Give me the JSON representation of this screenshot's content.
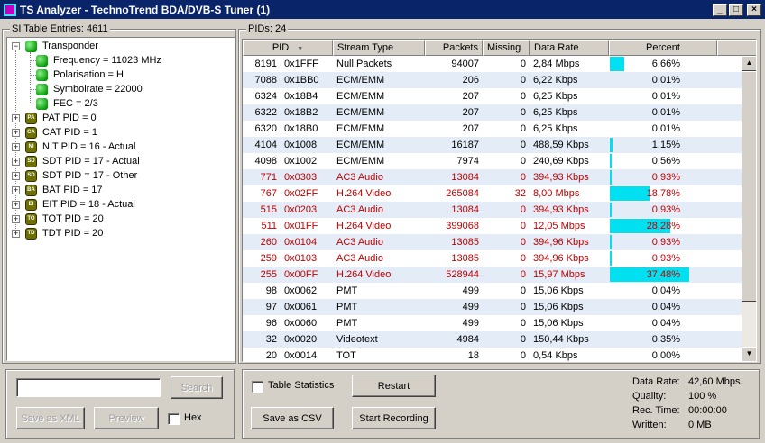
{
  "window": {
    "title": "TS Analyzer - TechnoTrend BDA/DVB-S Tuner (1)",
    "minimize": "_",
    "maximize": "□",
    "close": "×"
  },
  "si_panel": {
    "label": "SI Table Entries: 4611",
    "tree": [
      {
        "text": "Transponder",
        "icon": "green",
        "level": 0,
        "expander": "−"
      },
      {
        "text": "Frequency = 11023 MHz",
        "icon": "green",
        "level": 1
      },
      {
        "text": "Polarisation = H",
        "icon": "green",
        "level": 1
      },
      {
        "text": "Symbolrate = 22000",
        "icon": "green",
        "level": 1
      },
      {
        "text": "FEC = 2/3",
        "icon": "green",
        "level": 1
      },
      {
        "text": "PAT PID = 0",
        "icon": "PAT",
        "level": 0,
        "expander": "+"
      },
      {
        "text": "CAT PID = 1",
        "icon": "CAT",
        "level": 0,
        "expander": "+"
      },
      {
        "text": "NIT PID = 16 - Actual",
        "icon": "NIT",
        "level": 0,
        "expander": "+"
      },
      {
        "text": "SDT PID = 17 - Actual",
        "icon": "SDT",
        "level": 0,
        "expander": "+"
      },
      {
        "text": "SDT PID = 17 - Other",
        "icon": "SDT",
        "level": 0,
        "expander": "+"
      },
      {
        "text": "BAT PID = 17",
        "icon": "BAT",
        "level": 0,
        "expander": "+"
      },
      {
        "text": "EIT PID = 18 - Actual",
        "icon": "EIT",
        "level": 0,
        "expander": "+"
      },
      {
        "text": "TOT PID = 20",
        "icon": "TOT",
        "level": 0,
        "expander": "+"
      },
      {
        "text": "TDT PID = 20",
        "icon": "TDT",
        "level": 0,
        "expander": "+"
      }
    ],
    "search_value": "",
    "search_button": "Search",
    "save_xml_button": "Save as XML",
    "preview_button": "Preview",
    "hex_label": "Hex"
  },
  "pid_panel": {
    "label": "PIDs: 24",
    "columns": [
      "PID",
      "",
      "Stream Type",
      "Packets",
      "Missing",
      "Data Rate",
      "Percent"
    ],
    "sort_icon": "▼",
    "rows": [
      {
        "pid": "8191",
        "hex": "0x1FFF",
        "type": "Null Packets",
        "packets": "94007",
        "missing": "0",
        "rate": "2,84 Mbps",
        "percent": "6,66%",
        "pct": 6.66,
        "red": false
      },
      {
        "pid": "7088",
        "hex": "0x1BB0",
        "type": "ECM/EMM",
        "packets": "206",
        "missing": "0",
        "rate": "6,22 Kbps",
        "percent": "0,01%",
        "pct": 0.01,
        "red": false
      },
      {
        "pid": "6324",
        "hex": "0x18B4",
        "type": "ECM/EMM",
        "packets": "207",
        "missing": "0",
        "rate": "6,25 Kbps",
        "percent": "0,01%",
        "pct": 0.01,
        "red": false
      },
      {
        "pid": "6322",
        "hex": "0x18B2",
        "type": "ECM/EMM",
        "packets": "207",
        "missing": "0",
        "rate": "6,25 Kbps",
        "percent": "0,01%",
        "pct": 0.01,
        "red": false
      },
      {
        "pid": "6320",
        "hex": "0x18B0",
        "type": "ECM/EMM",
        "packets": "207",
        "missing": "0",
        "rate": "6,25 Kbps",
        "percent": "0,01%",
        "pct": 0.01,
        "red": false
      },
      {
        "pid": "4104",
        "hex": "0x1008",
        "type": "ECM/EMM",
        "packets": "16187",
        "missing": "0",
        "rate": "488,59 Kbps",
        "percent": "1,15%",
        "pct": 1.15,
        "red": false
      },
      {
        "pid": "4098",
        "hex": "0x1002",
        "type": "ECM/EMM",
        "packets": "7974",
        "missing": "0",
        "rate": "240,69 Kbps",
        "percent": "0,56%",
        "pct": 0.56,
        "red": false
      },
      {
        "pid": "771",
        "hex": "0x0303",
        "type": "AC3 Audio",
        "packets": "13084",
        "missing": "0",
        "rate": "394,93 Kbps",
        "percent": "0,93%",
        "pct": 0.93,
        "red": true
      },
      {
        "pid": "767",
        "hex": "0x02FF",
        "type": "H.264 Video",
        "packets": "265084",
        "missing": "32",
        "rate": "8,00 Mbps",
        "percent": "18,78%",
        "pct": 18.78,
        "red": true
      },
      {
        "pid": "515",
        "hex": "0x0203",
        "type": "AC3 Audio",
        "packets": "13084",
        "missing": "0",
        "rate": "394,93 Kbps",
        "percent": "0,93%",
        "pct": 0.93,
        "red": true
      },
      {
        "pid": "511",
        "hex": "0x01FF",
        "type": "H.264 Video",
        "packets": "399068",
        "missing": "0",
        "rate": "12,05 Mbps",
        "percent": "28,28%",
        "pct": 28.28,
        "red": true
      },
      {
        "pid": "260",
        "hex": "0x0104",
        "type": "AC3 Audio",
        "packets": "13085",
        "missing": "0",
        "rate": "394,96 Kbps",
        "percent": "0,93%",
        "pct": 0.93,
        "red": true
      },
      {
        "pid": "259",
        "hex": "0x0103",
        "type": "AC3 Audio",
        "packets": "13085",
        "missing": "0",
        "rate": "394,96 Kbps",
        "percent": "0,93%",
        "pct": 0.93,
        "red": true
      },
      {
        "pid": "255",
        "hex": "0x00FF",
        "type": "H.264 Video",
        "packets": "528944",
        "missing": "0",
        "rate": "15,97 Mbps",
        "percent": "37,48%",
        "pct": 37.48,
        "red": true
      },
      {
        "pid": "98",
        "hex": "0x0062",
        "type": "PMT",
        "packets": "499",
        "missing": "0",
        "rate": "15,06 Kbps",
        "percent": "0,04%",
        "pct": 0.04,
        "red": false
      },
      {
        "pid": "97",
        "hex": "0x0061",
        "type": "PMT",
        "packets": "499",
        "missing": "0",
        "rate": "15,06 Kbps",
        "percent": "0,04%",
        "pct": 0.04,
        "red": false
      },
      {
        "pid": "96",
        "hex": "0x0060",
        "type": "PMT",
        "packets": "499",
        "missing": "0",
        "rate": "15,06 Kbps",
        "percent": "0,04%",
        "pct": 0.04,
        "red": false
      },
      {
        "pid": "32",
        "hex": "0x0020",
        "type": "Videotext",
        "packets": "4984",
        "missing": "0",
        "rate": "150,44 Kbps",
        "percent": "0,35%",
        "pct": 0.35,
        "red": false
      },
      {
        "pid": "20",
        "hex": "0x0014",
        "type": "TOT",
        "packets": "18",
        "missing": "0",
        "rate": "0,54 Kbps",
        "percent": "0,00%",
        "pct": 0.0,
        "red": false
      }
    ],
    "table_stats_label": "Table Statistics",
    "restart_button": "Restart",
    "save_csv_button": "Save as CSV",
    "start_recording_button": "Start Recording",
    "stats": [
      {
        "label": "Data Rate:",
        "value": "42,60 Mbps"
      },
      {
        "label": "Quality:",
        "value": "100 %"
      },
      {
        "label": "Rec. Time:",
        "value": "00:00:00"
      },
      {
        "label": "Written:",
        "value": "0 MB"
      }
    ]
  },
  "colors": {
    "titlebar": "#0a246a",
    "percent_bar": "#00e0f0",
    "red_row_text": "#c00000",
    "alt_row": "#e4ecf7"
  }
}
